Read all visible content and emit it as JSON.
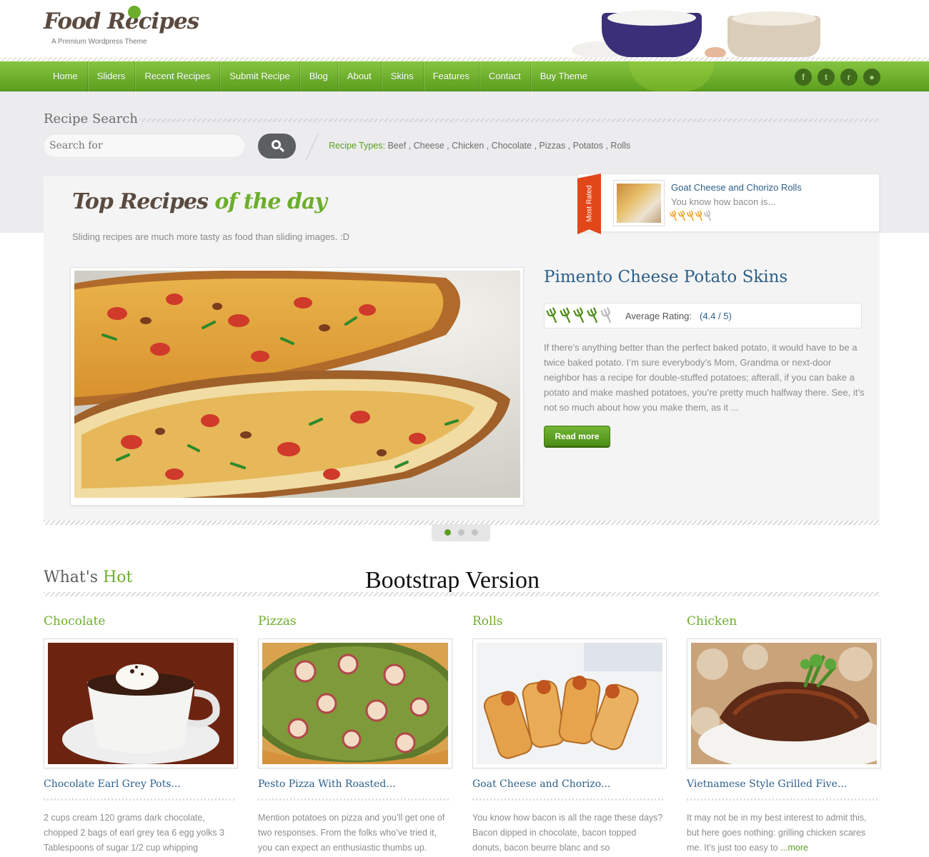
{
  "brand": {
    "logo_text": "Food Recipes",
    "tagline": "A Premium Wordpress Theme",
    "accent_green": "#6cae2b",
    "link_blue": "#2c5f8a"
  },
  "nav": {
    "items": [
      "Home",
      "Sliders",
      "Recent Recipes",
      "Submit Recipe",
      "Blog",
      "About",
      "Skins",
      "Features",
      "Contact",
      "Buy Theme"
    ],
    "social_icons": [
      "facebook-icon",
      "twitter-icon",
      "rss-icon",
      "flickr-icon"
    ],
    "social_glyphs": [
      "f",
      "t",
      "r",
      "●"
    ]
  },
  "search": {
    "title": "Recipe Search",
    "placeholder": "Search for",
    "types_label": "Recipe Types:",
    "types": "Beef , Cheese , Chicken , Chocolate , Pizzas , Potatos , Rolls"
  },
  "slider": {
    "heading_part1": "Top Recipes ",
    "heading_part2": "of the day",
    "subtitle": "Sliding recipes are much more tasty as food than sliding images. :D",
    "slide_title": "Pimento Cheese Potato Skins",
    "rating_label": "Average Rating:",
    "rating_value": "(4.4 / 5)",
    "rating": 4.4,
    "description": "If there’s anything better than the perfect baked potato, it would have to be a twice baked potato. I’m sure everybody’s Mom, Grandma or next-door neighbor has a recipe for double-stuffed potatoes; afterall, if you can bake a potato and make mashed potatoes, you’re pretty much halfway there. See, it’s not so much about how you make them, as it ...",
    "read_more": "Read more",
    "slide_count": 3,
    "active_slide": 1
  },
  "most_rated": {
    "ribbon": "Most Rated",
    "title": "Goat Cheese and Chorizo Rolls",
    "excerpt": "You know how bacon is...",
    "rating": 4
  },
  "whats_hot": {
    "title_part1": "What's ",
    "title_part2": "Hot",
    "overlay_label": "Bootstrap Version",
    "cards": [
      {
        "category": "Chocolate",
        "title": "Chocolate Earl Grey Pots...",
        "excerpt": "2 cups cream 120 grams dark chocolate, chopped 2 bags of earl grey tea 6 egg yolks 3 Tablespoons of sugar 1/2 cup whipping",
        "more": ""
      },
      {
        "category": "Pizzas",
        "title": "Pesto Pizza With Roasted...",
        "excerpt": "Mention potatoes on pizza and you’ll get one of two responses. From the folks who’ve tried it, you can expect an enthusiastic thumbs up.",
        "more": ""
      },
      {
        "category": "Rolls",
        "title": "Goat Cheese and Chorizo...",
        "excerpt": "You know how bacon is all the rage these days? Bacon dipped in chocolate, bacon topped donuts, bacon beurre blanc and so",
        "more": ""
      },
      {
        "category": "Chicken",
        "title": "Vietnamese Style Grilled Five...",
        "excerpt": "It may not be in my best interest to admit this, but here goes nothing: grilling chicken scares me. It’s just too easy to ",
        "more": "...more"
      }
    ]
  }
}
